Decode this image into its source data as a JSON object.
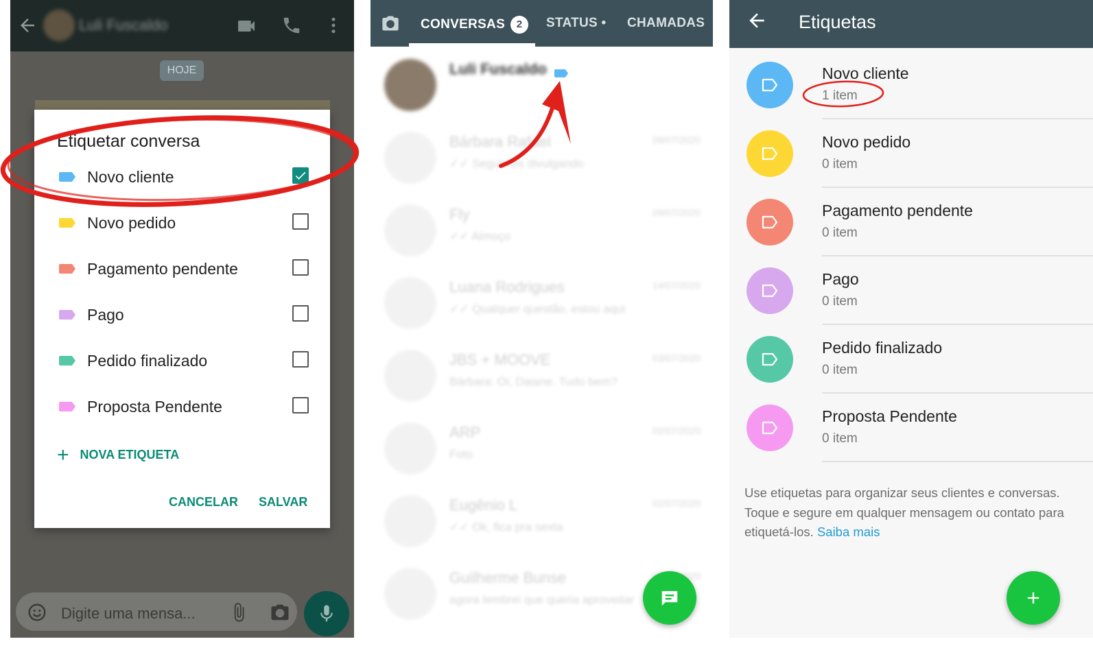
{
  "panel1": {
    "contact_name": "Luli Fuscaldo",
    "date_pill": "HOJE",
    "dialog": {
      "title": "Etiquetar conversa",
      "options": [
        {
          "label": "Novo cliente",
          "color": "#5bb8f5",
          "checked": true
        },
        {
          "label": "Novo pedido",
          "color": "#fdd835",
          "checked": false
        },
        {
          "label": "Pagamento pendente",
          "color": "#f48674",
          "checked": false
        },
        {
          "label": "Pago",
          "color": "#d7a8ee",
          "checked": false
        },
        {
          "label": "Pedido finalizado",
          "color": "#56c8a6",
          "checked": false
        },
        {
          "label": "Proposta Pendente",
          "color": "#f59af0",
          "checked": false
        }
      ],
      "new_label": "NOVA ETIQUETA",
      "cancel": "CANCELAR",
      "save": "SALVAR"
    },
    "input_placeholder": "Digite uma mensa...",
    "accent": "#0a8a76",
    "highlight_color": "#e0201b"
  },
  "panel2": {
    "tabs": {
      "conversas": "CONVERSAS",
      "conversas_badge": "2",
      "status": "STATUS •",
      "chamadas": "CHAMADAS"
    },
    "chats": [
      {
        "name": "Luli Fuscaldo",
        "snippet": "",
        "time": ""
      },
      {
        "name": "Bárbara Rafael",
        "snippet": "✓✓ Seguimos divulgando",
        "time": "09/07/2020"
      },
      {
        "name": "Fly",
        "snippet": "✓✓ Almoço",
        "time": "09/07/2020"
      },
      {
        "name": "Luana Rodrigues",
        "snippet": "✓✓ Qualquer questão, estou aqui",
        "time": "14/07/2020"
      },
      {
        "name": "JBS + MOOVE",
        "snippet": "Bárbara: Oi, Daiane. Tudo bem?",
        "time": "03/07/2020"
      },
      {
        "name": "ARP",
        "snippet": "Foto",
        "time": "02/07/2020"
      },
      {
        "name": "Eugênio L",
        "snippet": "✓✓ Ok, fica pra sexta",
        "time": "02/07/2020"
      },
      {
        "name": "Guilherme Bunse",
        "snippet": "agora lembrei que queria aproveitar",
        "time": "01/07/2020"
      }
    ],
    "tag_color": "#5bb8f5",
    "arrow_color": "#e0201b"
  },
  "panel3": {
    "title": "Etiquetas",
    "labels": [
      {
        "name": "Novo cliente",
        "count": "1 item",
        "color": "#5bb8f5"
      },
      {
        "name": "Novo pedido",
        "count": "0 item",
        "color": "#fdd835"
      },
      {
        "name": "Pagamento pendente",
        "count": "0 item",
        "color": "#f48674"
      },
      {
        "name": "Pago",
        "count": "0 item",
        "color": "#d7a8ee"
      },
      {
        "name": "Pedido finalizado",
        "count": "0 item",
        "color": "#56c8a6"
      },
      {
        "name": "Proposta Pendente",
        "count": "0 item",
        "color": "#f59af0"
      }
    ],
    "help_text": "Use etiquetas para organizar seus clientes e conversas. Toque e segure em qualquer mensagem ou contato para etiquetá-los.",
    "help_link": "Saiba mais"
  },
  "colors": {
    "header": "#3c5159",
    "fab": "#19c43f"
  },
  "icons": [
    "back-arrow-icon",
    "video-call-icon",
    "phone-icon",
    "more-vert-icon",
    "emoji-icon",
    "attach-icon",
    "camera-icon",
    "mic-icon",
    "label-icon",
    "new-chat-icon",
    "plus-icon",
    "check-icon"
  ]
}
